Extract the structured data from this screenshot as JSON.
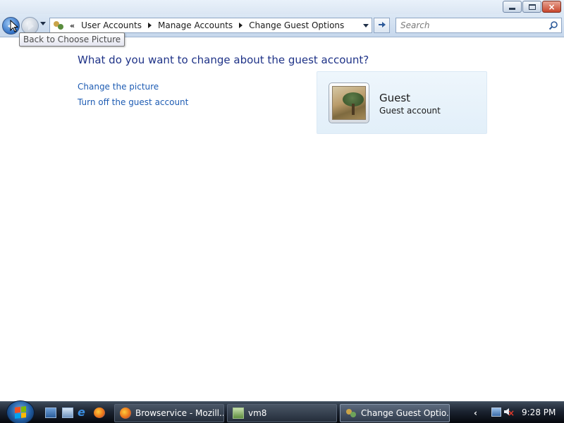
{
  "window": {
    "minimize_label": "",
    "maximize_label": "",
    "close_label": "×"
  },
  "address_bar": {
    "overflow_chevron": "«",
    "crumbs": [
      "User Accounts",
      "Manage Accounts",
      "Change Guest Options"
    ]
  },
  "search": {
    "placeholder": "Search"
  },
  "tooltip": {
    "text": "Back to Choose Picture"
  },
  "main": {
    "heading": "What do you want to change about the guest account?",
    "links": [
      "Change the picture",
      "Turn off the guest account"
    ],
    "account": {
      "name": "Guest",
      "type": "Guest account"
    }
  },
  "taskbar": {
    "buttons": [
      {
        "label": "Browservice - Mozill...",
        "icon": "firefox-icon"
      },
      {
        "label": "vm8",
        "icon": "vm-icon"
      },
      {
        "label": "Change Guest Optio...",
        "icon": "user-accounts-icon",
        "active": true
      }
    ],
    "tray_chevron": "‹",
    "clock": "9:28 PM"
  }
}
